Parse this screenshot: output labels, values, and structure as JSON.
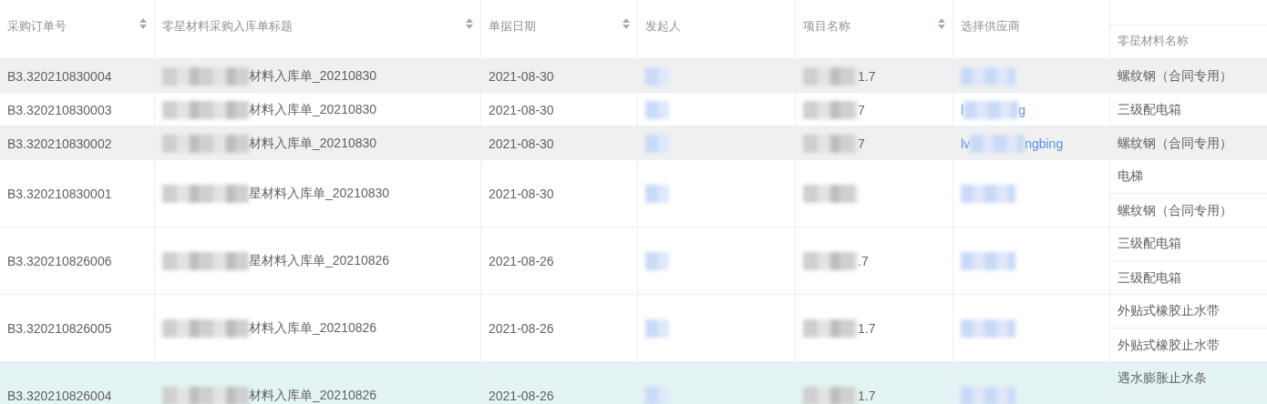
{
  "columns": [
    {
      "label": "采购订单号",
      "sortable": true
    },
    {
      "label": "零星材料采购入库单标题",
      "sortable": true
    },
    {
      "label": "单据日期",
      "sortable": true
    },
    {
      "label": "发起人",
      "sortable": false
    },
    {
      "label": "项目名称",
      "sortable": true
    },
    {
      "label": "选择供应商",
      "sortable": false
    },
    {
      "label": "零星材料名称",
      "sortable": false
    }
  ],
  "rows": [
    {
      "selected": false,
      "shaded": true,
      "order_no": "B3.320210830004",
      "title": [
        {
          "kind": "blur"
        },
        {
          "kind": "text",
          "text": "材料入库单_20210830"
        }
      ],
      "date": "2021-08-30",
      "initiator": [
        {
          "kind": "blur"
        }
      ],
      "project": [
        {
          "kind": "blur"
        },
        {
          "kind": "text",
          "text": "1.7"
        }
      ],
      "supplier": [
        {
          "kind": "blur"
        }
      ],
      "materials": [
        "螺纹钢（合同专用）"
      ],
      "continues_below": false
    },
    {
      "selected": false,
      "shaded": false,
      "order_no": "B3.320210830003",
      "title": [
        {
          "kind": "blur"
        },
        {
          "kind": "text",
          "text": "材料入库单_20210830"
        }
      ],
      "date": "2021-08-30",
      "initiator": [
        {
          "kind": "blur"
        }
      ],
      "project": [
        {
          "kind": "blur"
        },
        {
          "kind": "text",
          "text": "7"
        }
      ],
      "supplier": [
        {
          "kind": "text",
          "text": "l"
        },
        {
          "kind": "blur"
        },
        {
          "kind": "text",
          "text": "g"
        }
      ],
      "materials": [
        "三级配电箱"
      ],
      "continues_below": false
    },
    {
      "selected": false,
      "shaded": true,
      "order_no": "B3.320210830002",
      "title": [
        {
          "kind": "blur"
        },
        {
          "kind": "text",
          "text": "材料入库单_20210830"
        }
      ],
      "date": "2021-08-30",
      "initiator": [
        {
          "kind": "blur"
        }
      ],
      "project": [
        {
          "kind": "blur"
        },
        {
          "kind": "text",
          "text": "7"
        }
      ],
      "supplier": [
        {
          "kind": "text",
          "text": "lv"
        },
        {
          "kind": "blur"
        },
        {
          "kind": "text",
          "text": "ngbing"
        }
      ],
      "materials": [
        "螺纹钢（合同专用）"
      ],
      "continues_below": false
    },
    {
      "selected": false,
      "shaded": false,
      "order_no": "B3.320210830001",
      "title": [
        {
          "kind": "blur"
        },
        {
          "kind": "text",
          "text": "星材料入库单_20210830"
        }
      ],
      "date": "2021-08-30",
      "initiator": [
        {
          "kind": "blur"
        }
      ],
      "project": [
        {
          "kind": "blur"
        }
      ],
      "supplier": [
        {
          "kind": "blur"
        }
      ],
      "materials": [
        "电梯",
        "螺纹钢（合同专用）"
      ],
      "continues_below": false
    },
    {
      "selected": false,
      "shaded": false,
      "order_no": "B3.320210826006",
      "title": [
        {
          "kind": "blur"
        },
        {
          "kind": "text",
          "text": "星材料入库单_20210826"
        }
      ],
      "date": "2021-08-26",
      "initiator": [
        {
          "kind": "blur"
        }
      ],
      "project": [
        {
          "kind": "blur"
        },
        {
          "kind": "text",
          "text": ".7"
        }
      ],
      "supplier": [
        {
          "kind": "blur"
        }
      ],
      "materials": [
        "三级配电箱",
        "三级配电箱"
      ],
      "continues_below": false
    },
    {
      "selected": false,
      "shaded": false,
      "order_no": "B3.320210826005",
      "title": [
        {
          "kind": "blur"
        },
        {
          "kind": "text",
          "text": "材料入库单_20210826"
        }
      ],
      "date": "2021-08-26",
      "initiator": [
        {
          "kind": "blur"
        }
      ],
      "project": [
        {
          "kind": "blur"
        },
        {
          "kind": "text",
          "text": "1.7"
        }
      ],
      "supplier": [
        {
          "kind": "blur"
        }
      ],
      "materials": [
        "外贴式橡胶止水带",
        "外贴式橡胶止水带"
      ],
      "continues_below": false
    },
    {
      "selected": true,
      "shaded": false,
      "order_no": "B3.320210826004",
      "title": [
        {
          "kind": "blur"
        },
        {
          "kind": "text",
          "text": "材料入库单_20210826"
        }
      ],
      "date": "2021-08-26",
      "initiator": [
        {
          "kind": "blur"
        }
      ],
      "project": [
        {
          "kind": "blur"
        },
        {
          "kind": "text",
          "text": "1.7"
        }
      ],
      "supplier": [
        {
          "kind": "blur"
        }
      ],
      "materials": [
        "遇水膨胀止水条"
      ],
      "continues_below": true
    }
  ]
}
